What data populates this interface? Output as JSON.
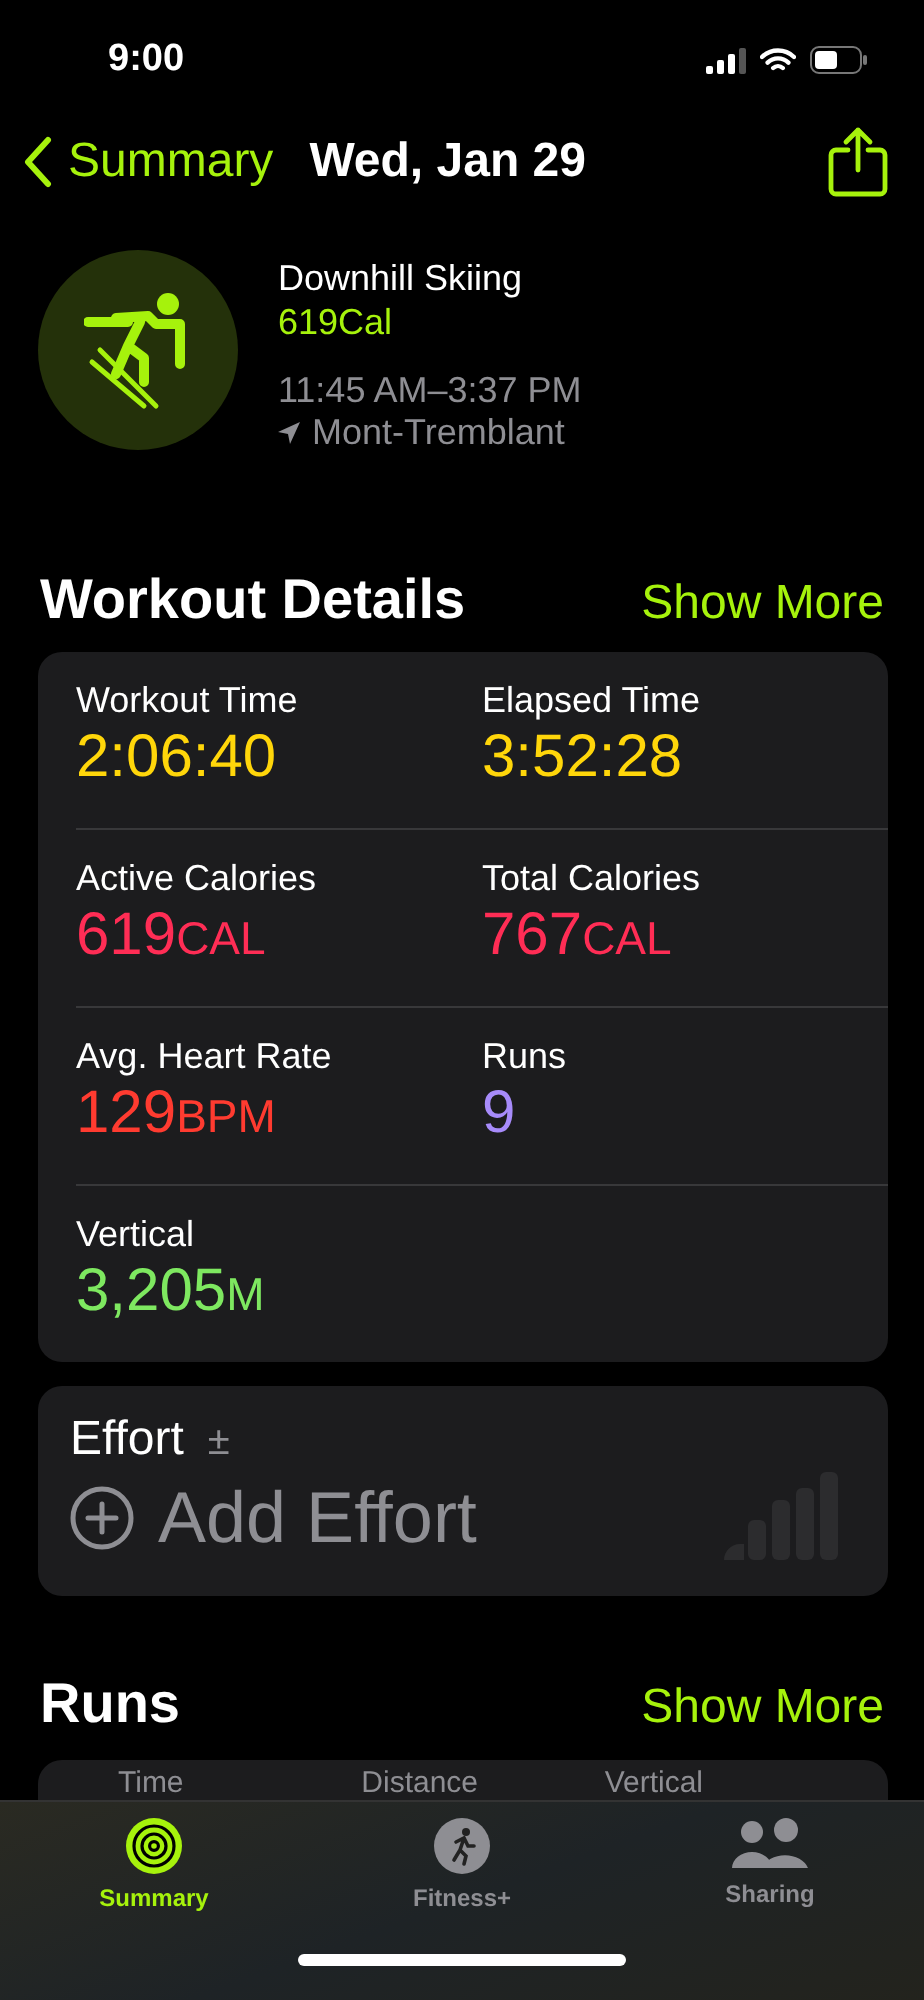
{
  "status_bar": {
    "time": "9:00"
  },
  "nav": {
    "back_label": "Summary",
    "title": "Wed, Jan 29"
  },
  "workout": {
    "name": "Downhill Skiing",
    "calories": "619Cal",
    "time_range": "11:45 AM–3:37 PM",
    "location": "Mont-Tremblant"
  },
  "details": {
    "title": "Workout Details",
    "action": "Show More",
    "metrics": [
      {
        "label": "Workout Time",
        "value": "2:06:40",
        "color": "#ffd60a"
      },
      {
        "label": "Elapsed Time",
        "value": "3:52:28",
        "color": "#ffd60a"
      },
      {
        "label": "Active Calories",
        "value": "619",
        "unit": "CAL",
        "color": "#ff2d55"
      },
      {
        "label": "Total Calories",
        "value": "767",
        "unit": "CAL",
        "color": "#ff2d55"
      },
      {
        "label": "Avg. Heart Rate",
        "value": "129",
        "unit": "BPM",
        "color": "#ff3b30"
      },
      {
        "label": "Runs",
        "value": "9",
        "color": "#a78bfa"
      },
      {
        "label": "Vertical",
        "value": "3,205",
        "unit": "M",
        "color": "#7ee860"
      }
    ]
  },
  "effort": {
    "title": "Effort",
    "symbol": "±",
    "add_label": "Add Effort"
  },
  "runs": {
    "title": "Runs",
    "action": "Show More",
    "columns": [
      "Time",
      "Distance",
      "Vertical"
    ]
  },
  "tab_bar": {
    "tabs": [
      {
        "label": "Summary",
        "selected": true
      },
      {
        "label": "Fitness+",
        "selected": false
      },
      {
        "label": "Sharing",
        "selected": false
      }
    ]
  }
}
